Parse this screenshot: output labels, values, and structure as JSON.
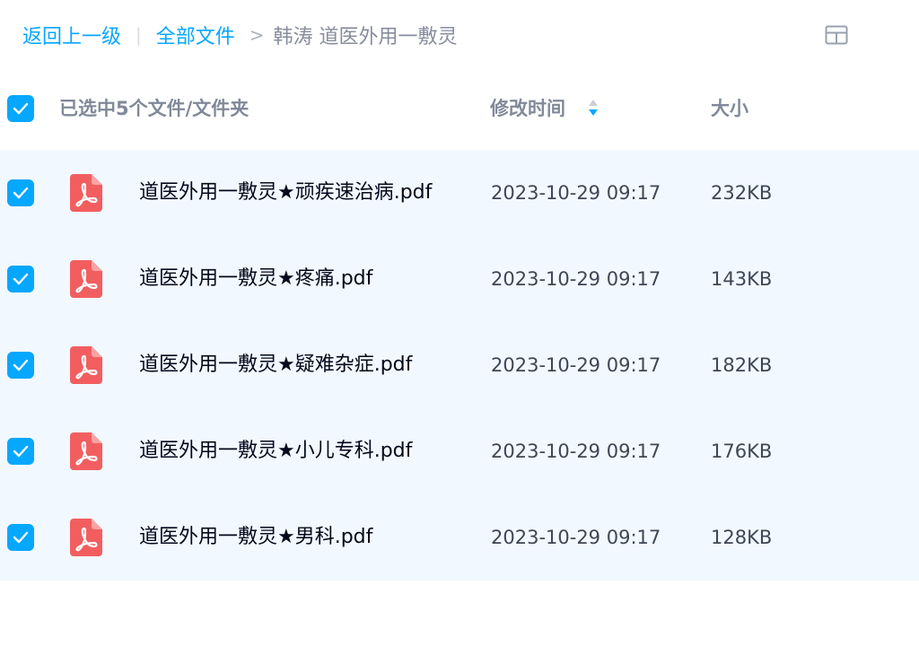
{
  "breadcrumb": {
    "back_label": "返回上一级",
    "root_label": "全部文件",
    "separator": ">",
    "current_label": "韩涛 道医外用一敷灵"
  },
  "toolbar": {
    "view_icon": "grid-view-icon"
  },
  "table_header": {
    "selected_label": "已选中5个文件/文件夹",
    "time_label": "修改时间",
    "size_label": "大小",
    "sort_icon": "sort-icon"
  },
  "colors": {
    "accent": "#06a7ff",
    "row_background": "#f2f8ff",
    "pdf_icon": "#f25e60"
  },
  "files": [
    {
      "name": "道医外用一敷灵★顽疾速治病.pdf",
      "modified": "2023-10-29 09:17",
      "size": "232KB",
      "checked": true,
      "icon": "pdf-icon"
    },
    {
      "name": "道医外用一敷灵★疼痛.pdf",
      "modified": "2023-10-29 09:17",
      "size": "143KB",
      "checked": true,
      "icon": "pdf-icon"
    },
    {
      "name": "道医外用一敷灵★疑难杂症.pdf",
      "modified": "2023-10-29 09:17",
      "size": "182KB",
      "checked": true,
      "icon": "pdf-icon"
    },
    {
      "name": "道医外用一敷灵★小儿专科.pdf",
      "modified": "2023-10-29 09:17",
      "size": "176KB",
      "checked": true,
      "icon": "pdf-icon"
    },
    {
      "name": "道医外用一敷灵★男科.pdf",
      "modified": "2023-10-29 09:17",
      "size": "128KB",
      "checked": true,
      "icon": "pdf-icon"
    }
  ]
}
